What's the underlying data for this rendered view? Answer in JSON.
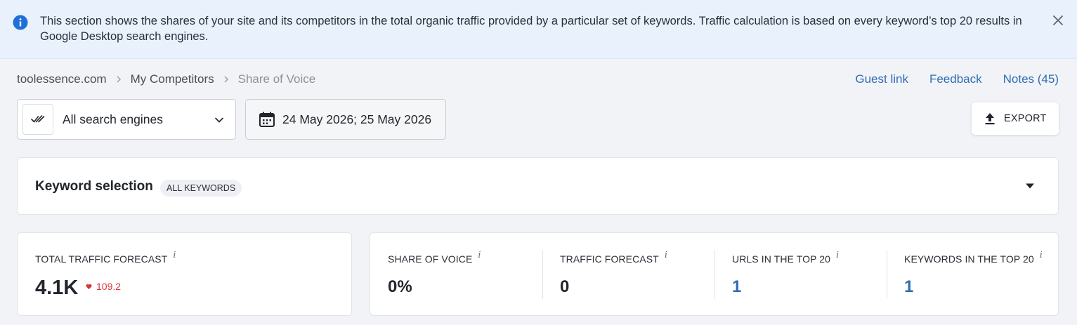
{
  "banner": {
    "text": "This section shows the shares of your site and its competitors in the total organic traffic provided by a particular set of keywords. Traffic calculation is based on every keyword’s top 20 results in Google Desktop search engines."
  },
  "breadcrumb": [
    "toolessence.com",
    "My Competitors",
    "Share of Voice"
  ],
  "toplinks": {
    "guest_link": "Guest link",
    "feedback": "Feedback",
    "notes": "Notes (45)"
  },
  "filters": {
    "search_engines": "All search engines",
    "date_range": "24 May 2026; 25 May 2026"
  },
  "export": {
    "label": "EXPORT"
  },
  "keyword_selection": {
    "title": "Keyword selection",
    "badge": "ALL KEYWORDS"
  },
  "total_traffic": {
    "label": "TOTAL TRAFFIC FORECAST",
    "value": "4.1K",
    "delta": "109.2"
  },
  "metrics": [
    {
      "label": "SHARE OF VOICE",
      "value": "0%"
    },
    {
      "label": "TRAFFIC FORECAST",
      "value": "0"
    },
    {
      "label": "URLS IN THE TOP 20",
      "value": "1"
    },
    {
      "label": "KEYWORDS IN THE TOP 20",
      "value": "1"
    }
  ],
  "info_glyph": "i",
  "colors": {
    "accent_link": "#2f6db5",
    "negative": "#d8353c",
    "banner_bg": "#e8f1fc",
    "info_blue": "#1e6fd9"
  }
}
